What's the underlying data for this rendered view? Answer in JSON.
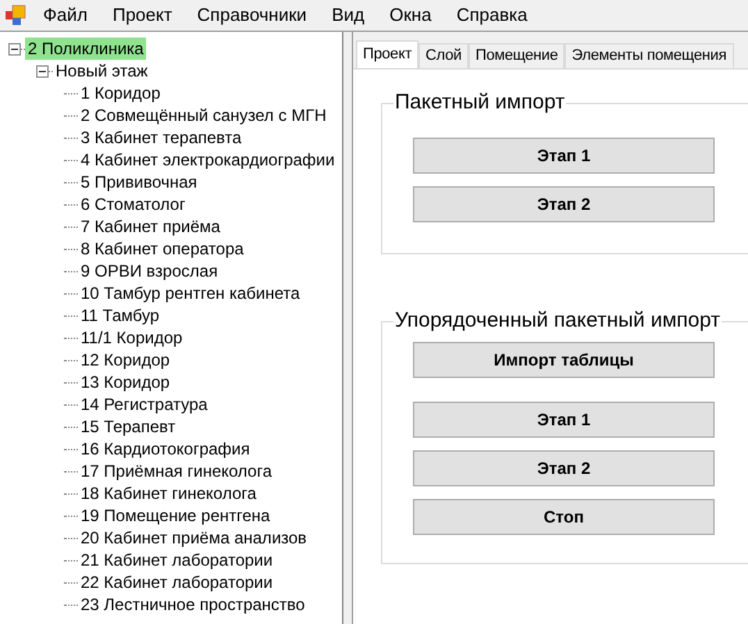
{
  "menu": [
    "Файл",
    "Проект",
    "Справочники",
    "Вид",
    "Окна",
    "Справка"
  ],
  "tree": [
    {
      "label": "2 Поликлиника",
      "selected": true,
      "expanded": true,
      "children": [
        {
          "label": "Новый этаж",
          "selected": false,
          "expanded": true,
          "children": [
            {
              "label": "1 Коридор",
              "selected": false
            },
            {
              "label": "2 Совмещённый санузел с МГН",
              "selected": false
            },
            {
              "label": "3 Кабинет терапевта",
              "selected": false
            },
            {
              "label": "4 Кабинет электрокардиографии",
              "selected": false
            },
            {
              "label": "5 Прививочная",
              "selected": false
            },
            {
              "label": "6 Стоматолог",
              "selected": false
            },
            {
              "label": "7 Кабинет приёма",
              "selected": false
            },
            {
              "label": "8 Кабинет оператора",
              "selected": false
            },
            {
              "label": "9 ОРВИ взрослая",
              "selected": false
            },
            {
              "label": "10 Тамбур рентген кабинета",
              "selected": false
            },
            {
              "label": "11 Тамбур",
              "selected": false
            },
            {
              "label": "11/1 Коридор",
              "selected": false
            },
            {
              "label": "12 Коридор",
              "selected": false
            },
            {
              "label": "13 Коридор",
              "selected": false
            },
            {
              "label": "14 Регистратура",
              "selected": false
            },
            {
              "label": "15 Терапевт",
              "selected": false
            },
            {
              "label": "16 Кардиотокография",
              "selected": false
            },
            {
              "label": "17 Приёмная гинеколога",
              "selected": false
            },
            {
              "label": "18 Кабинет гинеколога",
              "selected": false
            },
            {
              "label": "19 Помещение рентгена",
              "selected": false
            },
            {
              "label": "20 Кабинет приёма анализов",
              "selected": false
            },
            {
              "label": "21 Кабинет лаборатории",
              "selected": false
            },
            {
              "label": "22 Кабинет лаборатории",
              "selected": false
            },
            {
              "label": "23 Лестничное пространство",
              "selected": false
            }
          ]
        }
      ]
    }
  ],
  "tabs": [
    {
      "label": "Проект",
      "selected": true
    },
    {
      "label": "Слой",
      "selected": false
    },
    {
      "label": "Помещение",
      "selected": false
    },
    {
      "label": "Элементы помещения",
      "selected": false
    }
  ],
  "groups": [
    {
      "title": "Пакетный импорт",
      "buttons": [
        "Этап 1",
        "Этап 2"
      ]
    },
    {
      "title": "Упорядоченный пакетный импорт",
      "buttons": [
        "Импорт таблицы",
        "Этап 1",
        "Этап 2",
        "Стоп"
      ]
    }
  ]
}
